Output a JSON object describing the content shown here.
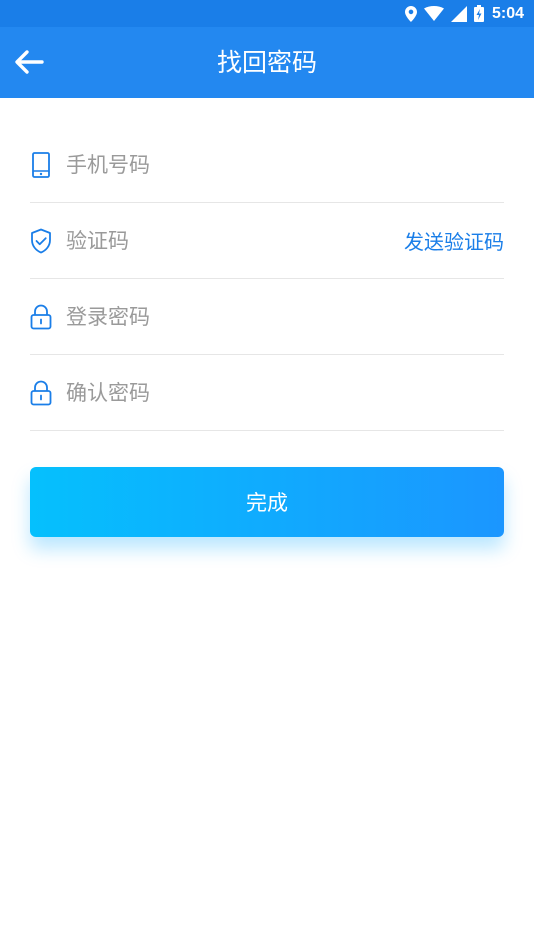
{
  "status_bar": {
    "time": "5:04",
    "icons": [
      "location-icon",
      "wifi-icon",
      "signal-icon",
      "battery-charging-icon"
    ]
  },
  "app_bar": {
    "back_icon": "arrow-left-icon",
    "title": "找回密码"
  },
  "form": {
    "phone": {
      "icon": "phone-icon",
      "placeholder": "手机号码",
      "value": ""
    },
    "code": {
      "icon": "shield-check-icon",
      "placeholder": "验证码",
      "value": "",
      "send_label": "发送验证码"
    },
    "password": {
      "icon": "lock-icon",
      "placeholder": "登录密码",
      "value": ""
    },
    "confirm_password": {
      "icon": "lock-icon",
      "placeholder": "确认密码",
      "value": ""
    }
  },
  "submit": {
    "label": "完成"
  },
  "colors": {
    "status_bar": "#1a7ee8",
    "app_bar": "#2388f0",
    "accent": "#1a7ee8",
    "button_gradient_start": "#05c0fd",
    "button_gradient_end": "#1b96ff",
    "placeholder": "#9a9a9a",
    "divider": "#e6e6e6"
  }
}
